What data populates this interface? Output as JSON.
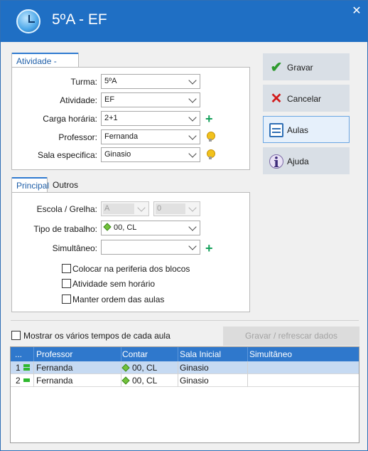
{
  "window": {
    "title": "5ºA - EF",
    "close": "✕"
  },
  "activity_group": {
    "tab": "Atividade - turma",
    "fields": [
      {
        "label": "Turma:",
        "value": "5ºA"
      },
      {
        "label": "Atividade:",
        "value": "EF"
      },
      {
        "label": "Carga horária:",
        "value": "2+1"
      },
      {
        "label": "Professor:",
        "value": "Fernanda"
      },
      {
        "label": "Sala especifica:",
        "value": "Ginasio"
      }
    ]
  },
  "sidebar": {
    "buttons": [
      {
        "label": "Gravar",
        "icon": "check-icon"
      },
      {
        "label": "Cancelar",
        "icon": "x-icon"
      },
      {
        "label": "Aulas",
        "icon": "lessons-icon"
      },
      {
        "label": "Ajuda",
        "icon": "help-icon"
      }
    ]
  },
  "principal": {
    "tabs": [
      "Principal",
      "Outros"
    ],
    "escola_label": "Escola / Grelha:",
    "escola_value": "A",
    "grelha_value": "0",
    "tipo_label": "Tipo de trabalho:",
    "tipo_value": "00, CL",
    "simultaneo_label": "Simultâneo:",
    "simultaneo_value": "",
    "checkboxes": [
      {
        "label": "Colocar na periferia dos blocos",
        "checked": false
      },
      {
        "label": "Atividade sem horário",
        "checked": false
      },
      {
        "label": "Manter ordem das aulas",
        "checked": false
      }
    ]
  },
  "footer": {
    "show_times_label": "Mostrar os vários tempos de cada aula",
    "refresh_label": "Gravar / refrescar dados"
  },
  "table": {
    "columns": [
      "...",
      "Professor",
      "Contar",
      "Sala Inicial",
      "Simultâneo"
    ],
    "rows": [
      {
        "num": "1",
        "professor": "Fernanda",
        "contar": "00, CL",
        "sala": "Ginasio",
        "simultaneo": ""
      },
      {
        "num": "2",
        "professor": "Fernanda",
        "contar": "00, CL",
        "sala": "Ginasio",
        "simultaneo": ""
      }
    ]
  },
  "colors": {
    "titlebar": "#1f6fc4",
    "accent": "#2f78cc",
    "plus": "#14a05a"
  }
}
